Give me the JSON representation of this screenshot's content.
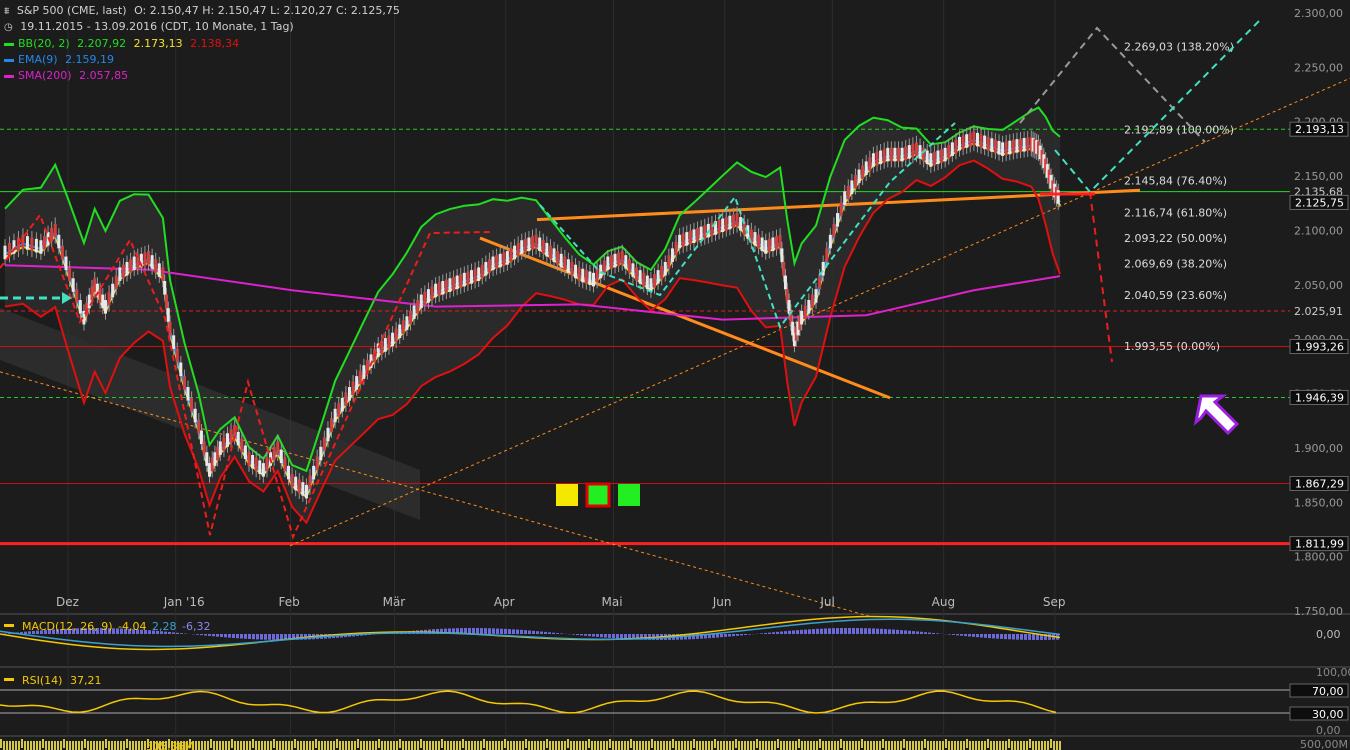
{
  "header": {
    "symbol": "S&P 500 (CME, last)",
    "ohlc": "O: 2.150,47  H: 2.150,47  L: 2.120,27  C: 2.125,75",
    "range": "19.11.2015 - 13.09.2016 (CDT, 10 Monate, 1 Tag)"
  },
  "legend": [
    {
      "name": "BB(20, 2)",
      "values": [
        "2.207,92",
        "2.173,13",
        "2.138,34"
      ],
      "colors": [
        "#22dd22",
        "#f5e12a",
        "#e01010"
      ]
    },
    {
      "name": "EMA(9)",
      "values": [
        "2.159,19"
      ],
      "colors": [
        "#2288ee"
      ]
    },
    {
      "name": "SMA(200)",
      "values": [
        "2.057,85"
      ],
      "colors": [
        "#dd22cc"
      ]
    }
  ],
  "chart_data": {
    "type": "candlestick",
    "ylim": [
      1750,
      2300
    ],
    "y_ticks": [
      {
        "v": 2300,
        "label": "2.300,00"
      },
      {
        "v": 2250,
        "label": "2.250,00"
      },
      {
        "v": 2200,
        "label": "2.200,00"
      },
      {
        "v": 2150,
        "label": "2.150,00"
      },
      {
        "v": 2100,
        "label": "2.100,00"
      },
      {
        "v": 2050,
        "label": "2.050,00"
      },
      {
        "v": 2000,
        "label": "2.000,00"
      },
      {
        "v": 1950,
        "label": "1.950,00"
      },
      {
        "v": 1900,
        "label": "1.900,00"
      },
      {
        "v": 1850,
        "label": "1.850,00"
      },
      {
        "v": 1800,
        "label": "1.800,00"
      },
      {
        "v": 1750,
        "label": "1.750,00"
      }
    ],
    "x_ticks": [
      {
        "day": 12,
        "label": "Dez"
      },
      {
        "day": 42,
        "label": "Jan '16"
      },
      {
        "day": 74,
        "label": "Feb"
      },
      {
        "day": 103,
        "label": "Mär"
      },
      {
        "day": 134,
        "label": "Apr"
      },
      {
        "day": 164,
        "label": "Mai"
      },
      {
        "day": 195,
        "label": "Jun"
      },
      {
        "day": 225,
        "label": "Jul"
      },
      {
        "day": 256,
        "label": "Aug"
      },
      {
        "day": 287,
        "label": "Sep"
      }
    ],
    "day_range": [
      0,
      301
    ],
    "close_path": [
      [
        0,
        2080
      ],
      [
        5,
        2090
      ],
      [
        10,
        2085
      ],
      [
        14,
        2100
      ],
      [
        18,
        2060
      ],
      [
        22,
        2020
      ],
      [
        25,
        2050
      ],
      [
        28,
        2030
      ],
      [
        32,
        2060
      ],
      [
        36,
        2070
      ],
      [
        40,
        2075
      ],
      [
        44,
        2060
      ],
      [
        46,
        2010
      ],
      [
        50,
        1960
      ],
      [
        54,
        1920
      ],
      [
        57,
        1880
      ],
      [
        60,
        1900
      ],
      [
        64,
        1915
      ],
      [
        68,
        1890
      ],
      [
        72,
        1880
      ],
      [
        76,
        1900
      ],
      [
        80,
        1870
      ],
      [
        84,
        1860
      ],
      [
        88,
        1895
      ],
      [
        92,
        1930
      ],
      [
        96,
        1950
      ],
      [
        100,
        1970
      ],
      [
        104,
        1990
      ],
      [
        108,
        2000
      ],
      [
        112,
        2015
      ],
      [
        116,
        2035
      ],
      [
        120,
        2045
      ],
      [
        124,
        2050
      ],
      [
        128,
        2055
      ],
      [
        132,
        2060
      ],
      [
        136,
        2070
      ],
      [
        140,
        2075
      ],
      [
        144,
        2085
      ],
      [
        148,
        2090
      ],
      [
        152,
        2080
      ],
      [
        156,
        2070
      ],
      [
        160,
        2060
      ],
      [
        164,
        2055
      ],
      [
        168,
        2070
      ],
      [
        172,
        2075
      ],
      [
        176,
        2060
      ],
      [
        180,
        2050
      ],
      [
        184,
        2065
      ],
      [
        188,
        2090
      ],
      [
        192,
        2095
      ],
      [
        196,
        2100
      ],
      [
        200,
        2105
      ],
      [
        204,
        2110
      ],
      [
        208,
        2095
      ],
      [
        212,
        2085
      ],
      [
        216,
        2090
      ],
      [
        218,
        2040
      ],
      [
        220,
        2000
      ],
      [
        222,
        2020
      ],
      [
        226,
        2040
      ],
      [
        230,
        2090
      ],
      [
        234,
        2130
      ],
      [
        238,
        2150
      ],
      [
        242,
        2165
      ],
      [
        246,
        2170
      ],
      [
        250,
        2170
      ],
      [
        254,
        2175
      ],
      [
        258,
        2165
      ],
      [
        262,
        2170
      ],
      [
        266,
        2180
      ],
      [
        270,
        2185
      ],
      [
        274,
        2180
      ],
      [
        278,
        2175
      ],
      [
        282,
        2178
      ],
      [
        286,
        2180
      ],
      [
        288,
        2176
      ],
      [
        290,
        2160
      ],
      [
        292,
        2140
      ],
      [
        294,
        2128
      ]
    ],
    "hlines": [
      {
        "v": 2193.13,
        "label": "2.193,13",
        "color": "#22cc22",
        "style": "dash",
        "highlight": true
      },
      {
        "v": 2135.68,
        "label": "2.135,68",
        "color": "#22dd22",
        "style": "solid",
        "highlight": false
      },
      {
        "v": 2125.75,
        "label": "2.125,75",
        "color": "#ffffff",
        "style": "none",
        "highlight": true
      },
      {
        "v": 2025.91,
        "label": "2.025,91",
        "color": "#dd2020",
        "style": "dash",
        "highlight": false
      },
      {
        "v": 1993.26,
        "label": "1.993,26",
        "color": "#cc1010",
        "style": "solid",
        "highlight": true
      },
      {
        "v": 1946.39,
        "label": "1.946,39",
        "color": "#22cc22",
        "style": "dash",
        "highlight": true
      },
      {
        "v": 1867.29,
        "label": "1.867,29",
        "color": "#cc1010",
        "style": "solid",
        "highlight": true
      },
      {
        "v": 1811.99,
        "label": "1.811,99",
        "color": "#ff2020",
        "style": "thick",
        "highlight": true
      }
    ],
    "fib_levels": [
      {
        "v": 2269.03,
        "label": "2.269,03 (138.20%)"
      },
      {
        "v": 2192.89,
        "label": "2.192,89 (100.00%)"
      },
      {
        "v": 2145.84,
        "label": "2.145,84 (76.40%)"
      },
      {
        "v": 2116.74,
        "label": "2.116,74 (61.80%)"
      },
      {
        "v": 2093.22,
        "label": "2.093,22 (50.00%)"
      },
      {
        "v": 2069.69,
        "label": "2.069,69 (38.20%)"
      },
      {
        "v": 2040.59,
        "label": "2.040,59 (23.60%)"
      },
      {
        "v": 1993.55,
        "label": "1.993,55 (0.00%)"
      }
    ],
    "macd": {
      "label": "MACD(12, 26, 9)",
      "values": [
        "-4,04",
        "2,28",
        "-6,32"
      ],
      "zero_label": "0,00"
    },
    "rsi": {
      "label": "RSI(14)",
      "value": "37,21",
      "levels": [
        "100,00",
        "70,00",
        "30,00",
        "0,00"
      ]
    },
    "volume": {
      "value": "505,86M",
      "scale_label": "500,00M"
    }
  }
}
